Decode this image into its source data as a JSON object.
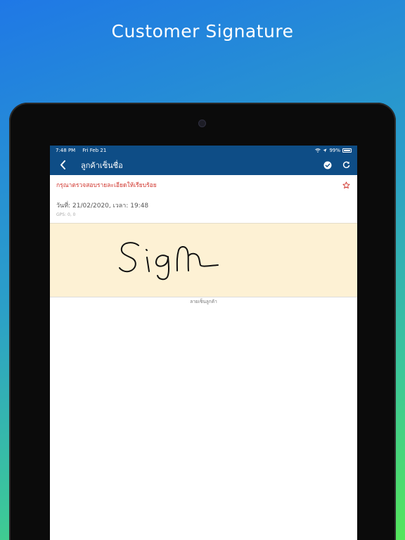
{
  "promo": {
    "title": "Customer Signature"
  },
  "status_bar": {
    "time": "7:48 PM",
    "date": "Fri Feb 21",
    "battery": "99%"
  },
  "nav": {
    "title": "ลูกค้าเซ็นชื่อ",
    "back_icon": "chevron-left-icon",
    "confirm_icon": "check-circle-icon",
    "refresh_icon": "refresh-icon"
  },
  "form": {
    "warning": "กรุณาตรวจสอบรายละเอียดให้เรียบร้อย",
    "datetime": "วันที่: 21/02/2020, เวลา: 19:48",
    "gps": "GPS: 0, 0",
    "signature_caption": "ลายเซ็นลูกค้า"
  },
  "colors": {
    "nav_bg": "#0e4d86",
    "warning": "#d0342c",
    "pad_bg": "#fdf1d4"
  }
}
